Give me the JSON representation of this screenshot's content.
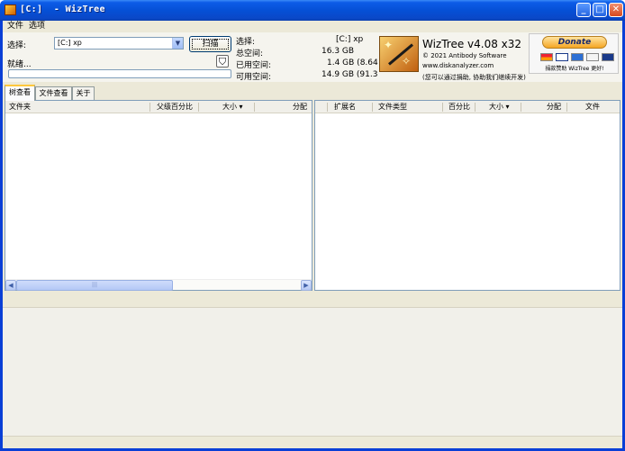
{
  "window": {
    "title": "[C:]  - WizTree"
  },
  "menu": [
    "文件",
    "选项"
  ],
  "scan": {
    "select_label": "选择:",
    "drive_value": "[C:] xp",
    "scan_button": "扫描",
    "status_text": "就绪..."
  },
  "stats": {
    "labels": [
      "选择:",
      "总空间:",
      "已用空间:",
      "可用空间:"
    ],
    "values": [
      "[C:]  xp",
      "16.3 GB",
      "1.4 GB  (8.64",
      "14.9 GB  (91.3"
    ]
  },
  "about": {
    "product": "WizTree v4.08 x32",
    "copyright": "© 2021 Antibody Software",
    "url": "www.diskanalyzer.com",
    "note": "(您可以通过捐助, 协助我们继续开发)"
  },
  "donate": {
    "button": "Donate",
    "caption": "捐款赞助 WizTree 更好!"
  },
  "tabs": [
    "树查看",
    "文件查看",
    "关于"
  ],
  "left_columns": [
    "文件夹",
    "父级百分比",
    "大小 ▾",
    "分配"
  ],
  "right_columns": [
    "扩展名",
    "文件类型",
    "百分比",
    "大小 ▾",
    "分配",
    "文件"
  ],
  "icons": {
    "app": "wiztree-icon",
    "minimize": "minimize-icon",
    "maximize": "maximize-icon",
    "close": "close-icon",
    "filter": "filter-icon",
    "dropdown": "chevron-down-icon"
  }
}
